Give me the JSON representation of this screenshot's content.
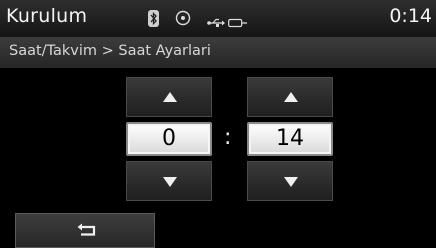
{
  "header": {
    "title": "Kurulum",
    "time": "0:14",
    "icons": [
      "bluetooth-icon",
      "disc-icon",
      "usb-icon",
      "aux-icon"
    ]
  },
  "breadcrumb": "Saat/Takvim > Saat Ayarlari",
  "clock_setting": {
    "hour": "0",
    "minute": "14",
    "separator": ":"
  },
  "footer": {
    "back_icon": "return-arrow-icon"
  }
}
